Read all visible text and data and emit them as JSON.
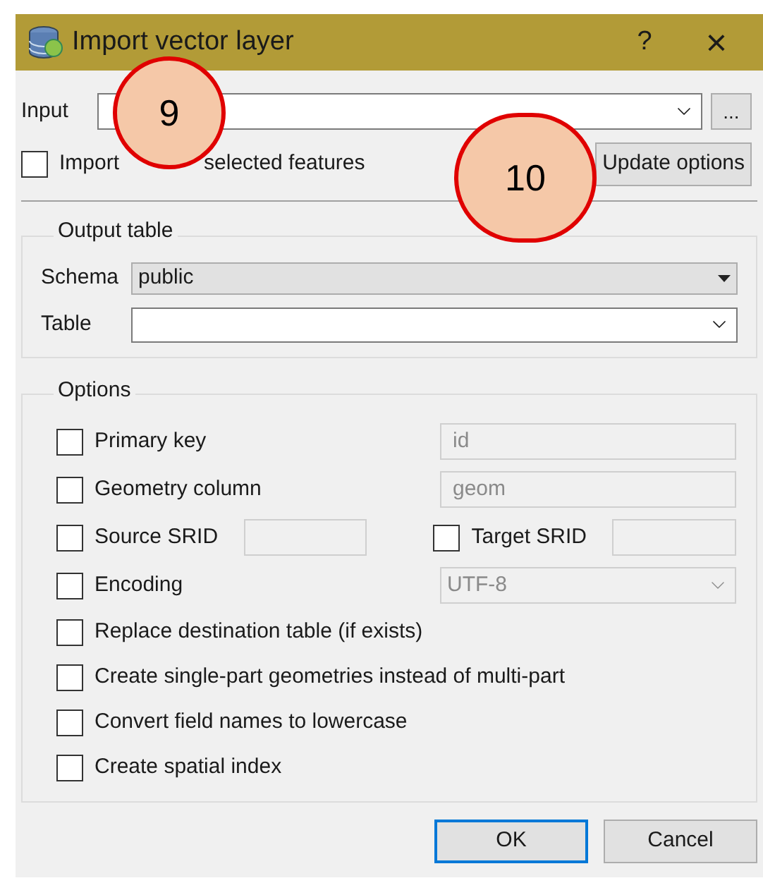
{
  "window": {
    "title": "Import vector layer",
    "help": "?",
    "close": "×"
  },
  "input": {
    "label": "Input",
    "browse": "..."
  },
  "import_selected": {
    "label_parts": [
      "Import",
      "selected features"
    ],
    "checked": false
  },
  "update_button": "Update options",
  "output_table": {
    "title": "Output table",
    "schema": {
      "label": "Schema",
      "value": "public"
    },
    "table": {
      "label": "Table"
    }
  },
  "options": {
    "title": "Options",
    "items": [
      {
        "kind": "field",
        "label": "Primary key",
        "checked": false,
        "value": "id",
        "disabled": true
      },
      {
        "kind": "field",
        "label": "Geometry column",
        "checked": false,
        "value": "geom",
        "disabled": true
      },
      {
        "kind": "pair",
        "label": "Source SRID",
        "checked": false,
        "disabled": true,
        "label2": "Target SRID",
        "checked2": false
      },
      {
        "kind": "select",
        "label": "Encoding",
        "checked": false,
        "value": "UTF-8",
        "disabled": true
      },
      {
        "kind": "check",
        "label": "Replace destination table (if exists)",
        "checked": false
      },
      {
        "kind": "check",
        "label": "Create single-part geometries instead of multi-part",
        "checked": false
      },
      {
        "kind": "check",
        "label": "Convert field names to lowercase",
        "checked": false
      },
      {
        "kind": "check",
        "label": "Create spatial index",
        "checked": false
      }
    ]
  },
  "buttons": [
    {
      "label": "OK",
      "selected": true
    },
    {
      "label": "Cancel",
      "selected": false
    }
  ],
  "callouts": [
    "9",
    "10"
  ]
}
